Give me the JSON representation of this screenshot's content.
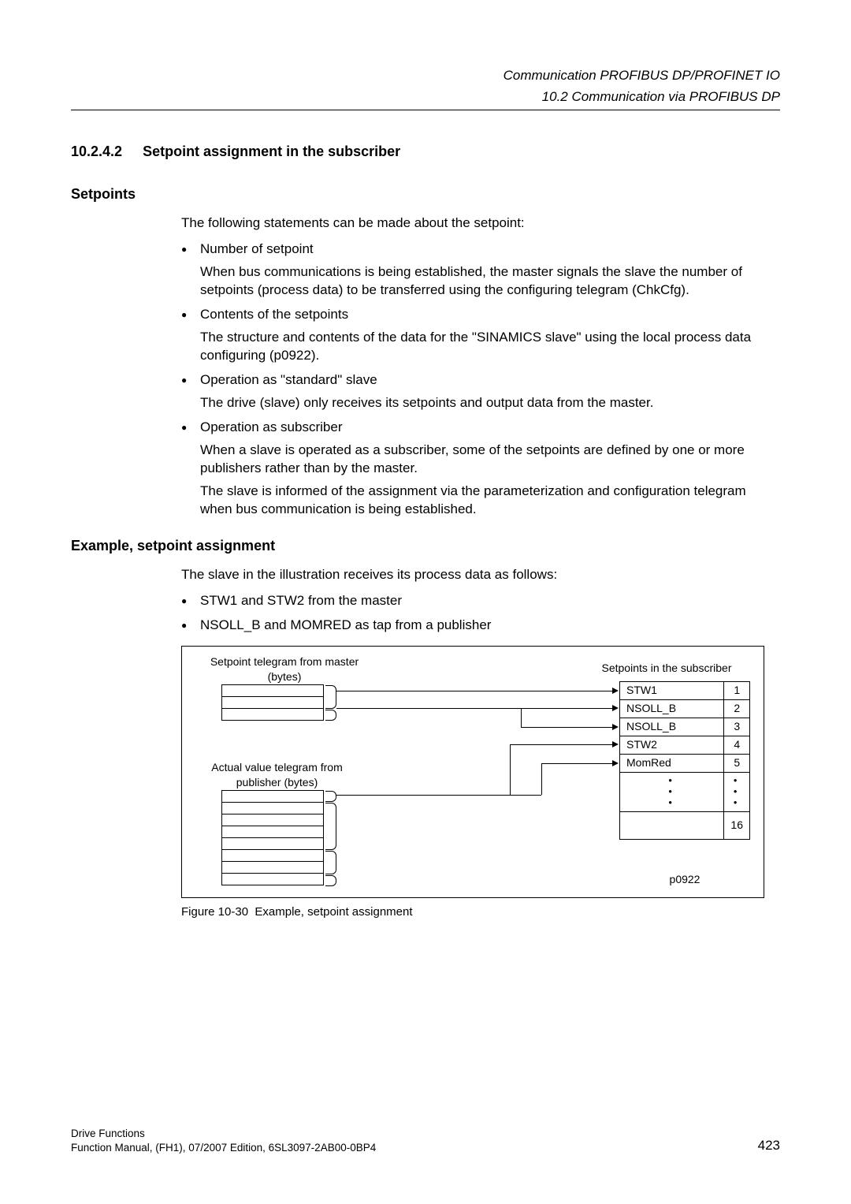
{
  "header": {
    "line1": "Communication PROFIBUS DP/PROFINET IO",
    "line2": "10.2 Communication via PROFIBUS DP"
  },
  "section": {
    "number": "10.2.4.2",
    "title": "Setpoint assignment in the subscriber"
  },
  "setpoints": {
    "heading": "Setpoints",
    "intro": "The following statements can be made about the setpoint:",
    "items": [
      {
        "title": "Number of setpoint",
        "para": "When bus communications is being established, the master signals the slave the number of setpoints (process data) to be transferred using the configuring telegram (ChkCfg)."
      },
      {
        "title": "Contents of the setpoints",
        "para": "The structure and contents of the data for the \"SINAMICS slave\" using the local process data configuring (p0922)."
      },
      {
        "title": "Operation as \"standard\" slave",
        "para": "The drive (slave) only receives its setpoints and output data from the master."
      },
      {
        "title": "Operation as subscriber",
        "para": "When a slave is operated as a subscriber, some of the setpoints are defined by one or more publishers rather than by the master.",
        "para2": "The slave is informed of the assignment via the parameterization and configuration telegram when bus communication is being established."
      }
    ]
  },
  "example": {
    "heading": "Example, setpoint assignment",
    "intro": "The slave in the illustration receives its process data as follows:",
    "bullets": [
      "STW1 and STW2 from the master",
      "NSOLL_B and MOMRED as tap from a publisher"
    ]
  },
  "figure": {
    "label_master": "Setpoint telegram from master (bytes)",
    "label_sub": "Setpoints in the subscriber",
    "label_actual": "Actual value telegram from publisher (bytes)",
    "rows": [
      {
        "name": "STW1",
        "idx": "1"
      },
      {
        "name": "NSOLL_B",
        "idx": "2"
      },
      {
        "name": "NSOLL_B",
        "idx": "3"
      },
      {
        "name": "STW2",
        "idx": "4"
      },
      {
        "name": "MomRed",
        "idx": "5"
      }
    ],
    "dots": "●   ●   ●",
    "dotsidx": "●\n●\n●",
    "last_idx": "16",
    "param": "p0922",
    "caption_prefix": "Figure 10-30",
    "caption_text": "Example, setpoint assignment"
  },
  "footer": {
    "line1": "Drive Functions",
    "line2": "Function Manual, (FH1), 07/2007 Edition, 6SL3097-2AB00-0BP4",
    "page": "423"
  }
}
